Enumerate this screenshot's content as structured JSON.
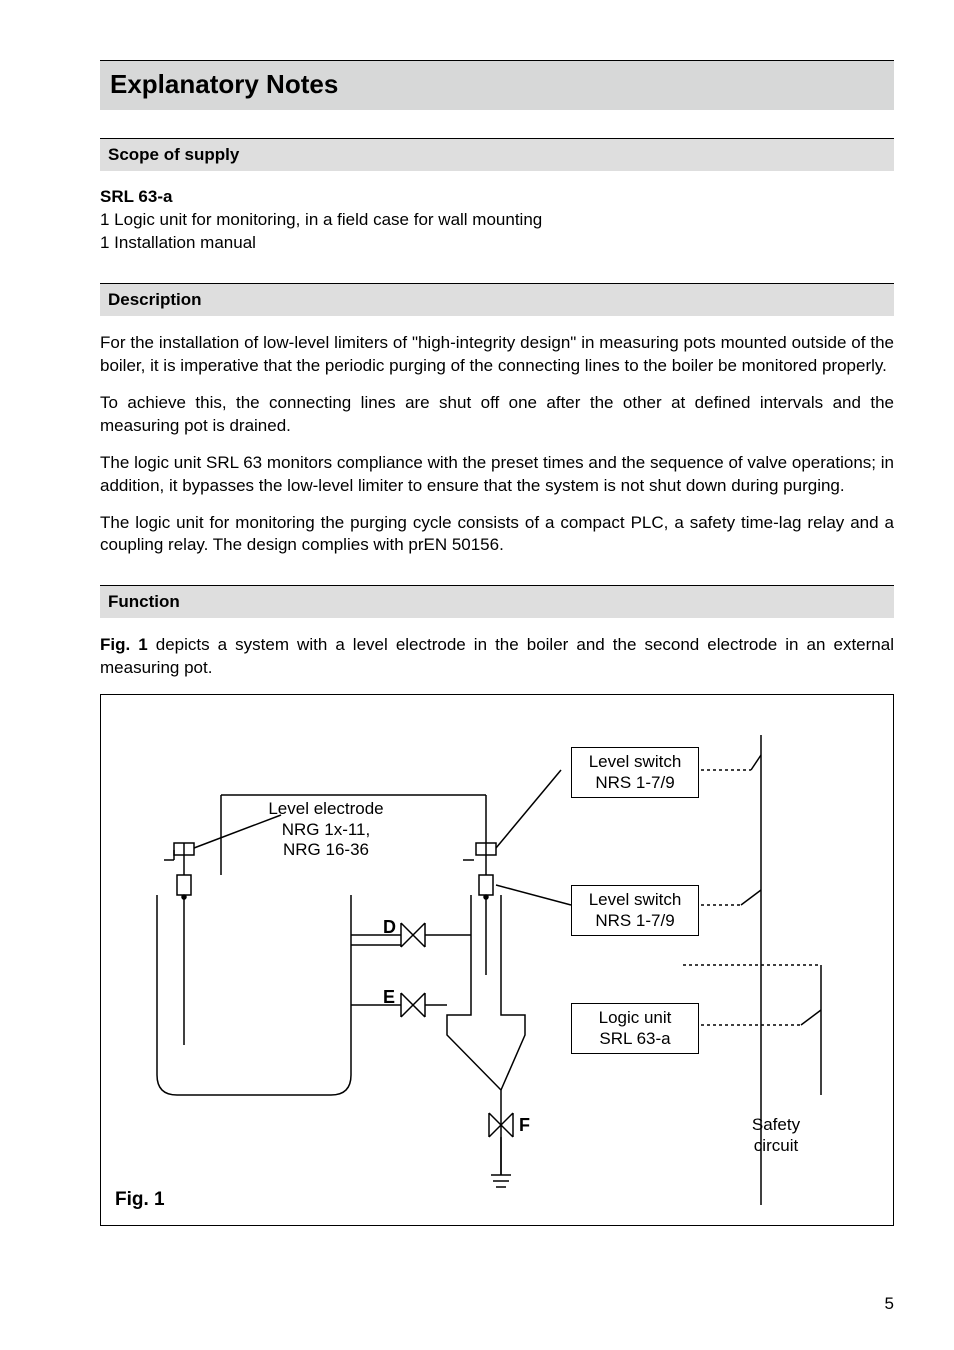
{
  "page_title": "Explanatory Notes",
  "sections": {
    "scope": {
      "heading": "Scope of supply",
      "product": "SRL 63-a",
      "items": [
        "1 Logic unit for monitoring, in a field case for wall mounting",
        "1 Installation manual"
      ]
    },
    "description": {
      "heading": "Description",
      "paragraphs": [
        "For the installation of low-level limiters of \"high-integrity design\" in measuring pots mounted outside of the boiler, it is imperative that the periodic purging of the connecting lines to the boiler be monitored properly.",
        "To achieve this, the connecting lines are shut off one after the other at defined intervals and the measuring pot is drained.",
        "The logic unit SRL 63 monitors compliance with the preset times and the sequence of valve operations; in addition, it bypasses the low-level limiter to ensure that the system is not shut down during purging.",
        "The logic unit for monitoring the purging cycle consists of a compact PLC, a safety time-lag relay and a coupling relay. The design complies with prEN 50156."
      ]
    },
    "function": {
      "heading": "Function",
      "intro_prefix_bold": "Fig. 1",
      "intro_rest": " depicts a system with a level electrode in the boiler and the second electrode in an external measuring pot."
    }
  },
  "figure": {
    "caption": "Fig. 1",
    "labels": {
      "level_electrode": "Level electrode\nNRG 1x-11,\nNRG 16-36",
      "level_switch_top": "Level switch\nNRS 1-7/9",
      "level_switch_mid": "Level switch\nNRS 1-7/9",
      "logic_unit": "Logic unit\nSRL 63-a",
      "safety_circuit": "Safety\ncircuit",
      "valve_d": "D",
      "valve_e": "E",
      "valve_f": "F"
    }
  },
  "page_number": "5"
}
